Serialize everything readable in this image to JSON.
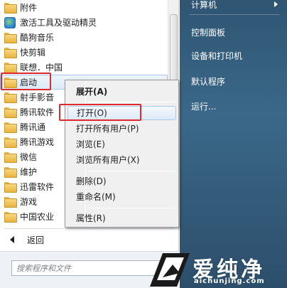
{
  "program_list": {
    "items": [
      {
        "label": "附件",
        "icon": "folder-icon"
      },
      {
        "label": "激活工具及驱动精灵",
        "icon": "app-icon"
      },
      {
        "label": "酷狗音乐",
        "icon": "folder-icon"
      },
      {
        "label": "快剪辑",
        "icon": "folder-icon"
      },
      {
        "label": "联想．中国",
        "icon": "folder-icon"
      },
      {
        "label": "启动",
        "icon": "folder-icon"
      },
      {
        "label": "射手影音",
        "icon": "folder-icon"
      },
      {
        "label": "腾讯软件",
        "icon": "folder-icon"
      },
      {
        "label": "腾讯通",
        "icon": "folder-icon"
      },
      {
        "label": "腾讯游戏",
        "icon": "folder-icon"
      },
      {
        "label": "微信",
        "icon": "folder-icon"
      },
      {
        "label": "维护",
        "icon": "folder-icon"
      },
      {
        "label": "迅雷软件",
        "icon": "folder-icon"
      },
      {
        "label": "游戏",
        "icon": "folder-icon"
      },
      {
        "label": "中国农业",
        "icon": "folder-icon"
      }
    ],
    "back_label": "返回"
  },
  "search": {
    "placeholder": "搜索程序和文件"
  },
  "right_panel": {
    "items": [
      {
        "label": "计算机"
      },
      {
        "label": "控制面板"
      },
      {
        "label": "设备和打印机"
      },
      {
        "label": "默认程序"
      },
      {
        "label": "运行..."
      }
    ]
  },
  "context_menu": {
    "expand": "展开(A)",
    "open": "打开(O)",
    "open_all_users": "打开所有用户(P)",
    "browse": "浏览(E)",
    "browse_all_users": "浏览所有用户(X)",
    "delete": "删除(D)",
    "rename": "重命名(M)",
    "properties": "属性(R)"
  },
  "watermark": {
    "brand": "爱纯净",
    "site": "aichunjing.com"
  },
  "colors": {
    "highlight_box": "#e0282f",
    "right_panel": "#3b6889",
    "selection": "#dbe9f8"
  }
}
